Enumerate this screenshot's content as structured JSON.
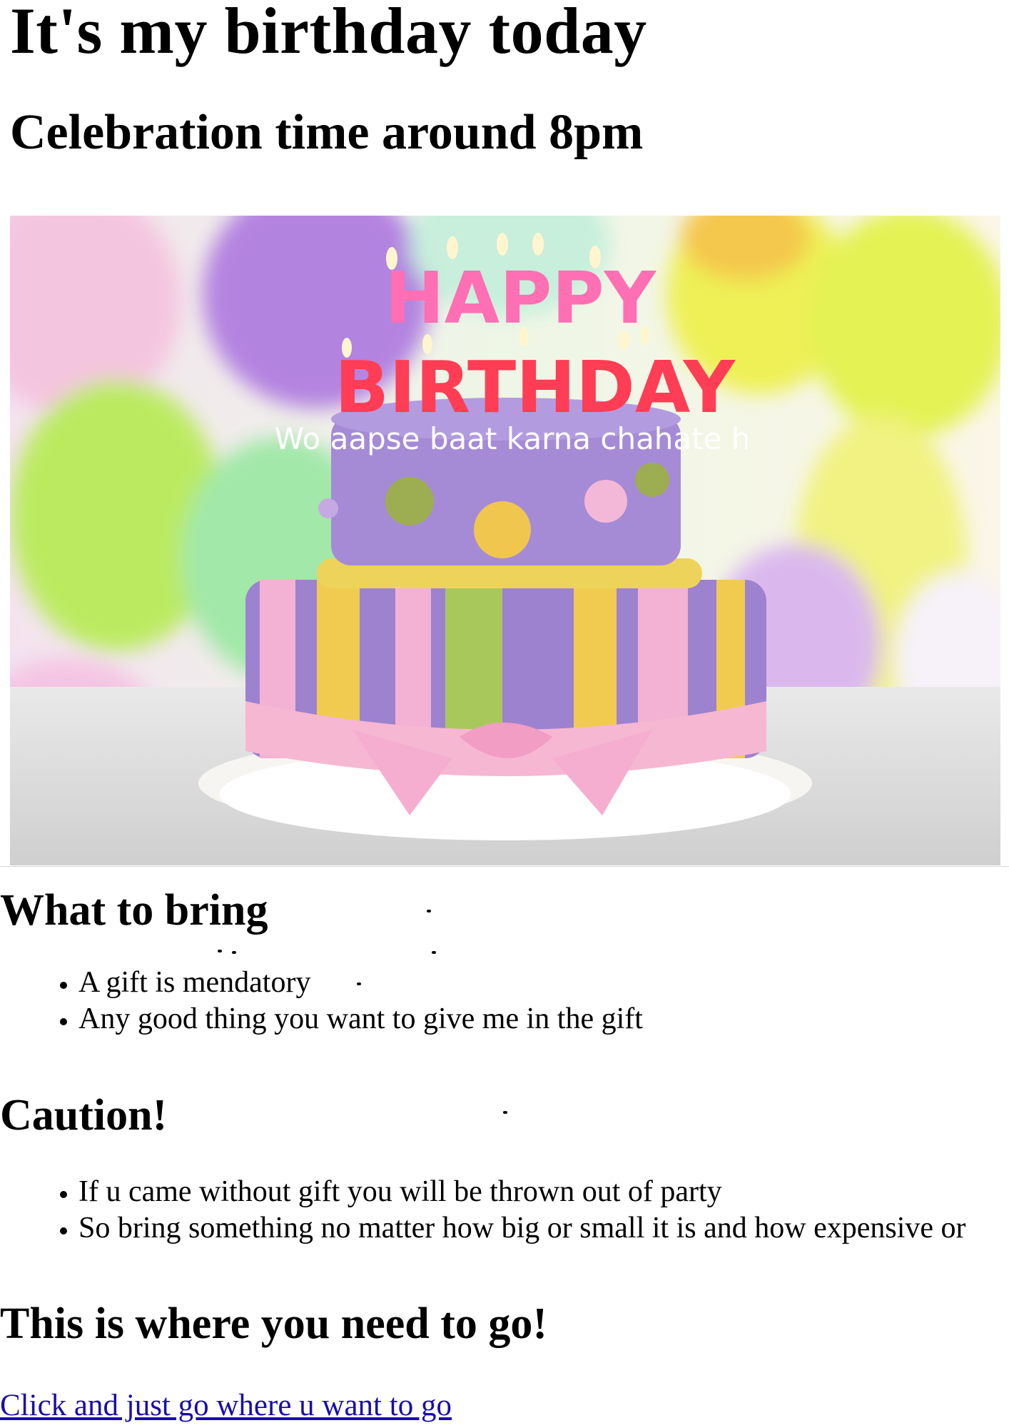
{
  "header": {
    "title": "It's my birthday today",
    "subtitle": "Celebration time around 8pm"
  },
  "hero_image": {
    "description_icon": "birthday-cake-image",
    "candle_text_top": "HAPPY",
    "candle_text_bottom": "BIRTHDAY",
    "overlay_text": "Wo aapse baat karna chahate h"
  },
  "what_to_bring": {
    "heading": "What to bring",
    "items": [
      "A gift is mendatory",
      "Any good thing you want to give me in the gift"
    ]
  },
  "caution": {
    "heading": "Caution!",
    "items": [
      "If u came without gift you will be thrown out of party",
      "So bring something no matter how big or small it is and how expensive or"
    ]
  },
  "directions": {
    "heading": "This is where you need to go!",
    "link_text": "Click and just go where u want to go"
  },
  "colors": {
    "link": "#1a0dab",
    "cake_purple": "#9d82cf",
    "cake_pink": "#f3b2d3",
    "cake_yellow": "#f1cb4f",
    "cake_green": "#a9c85c"
  }
}
